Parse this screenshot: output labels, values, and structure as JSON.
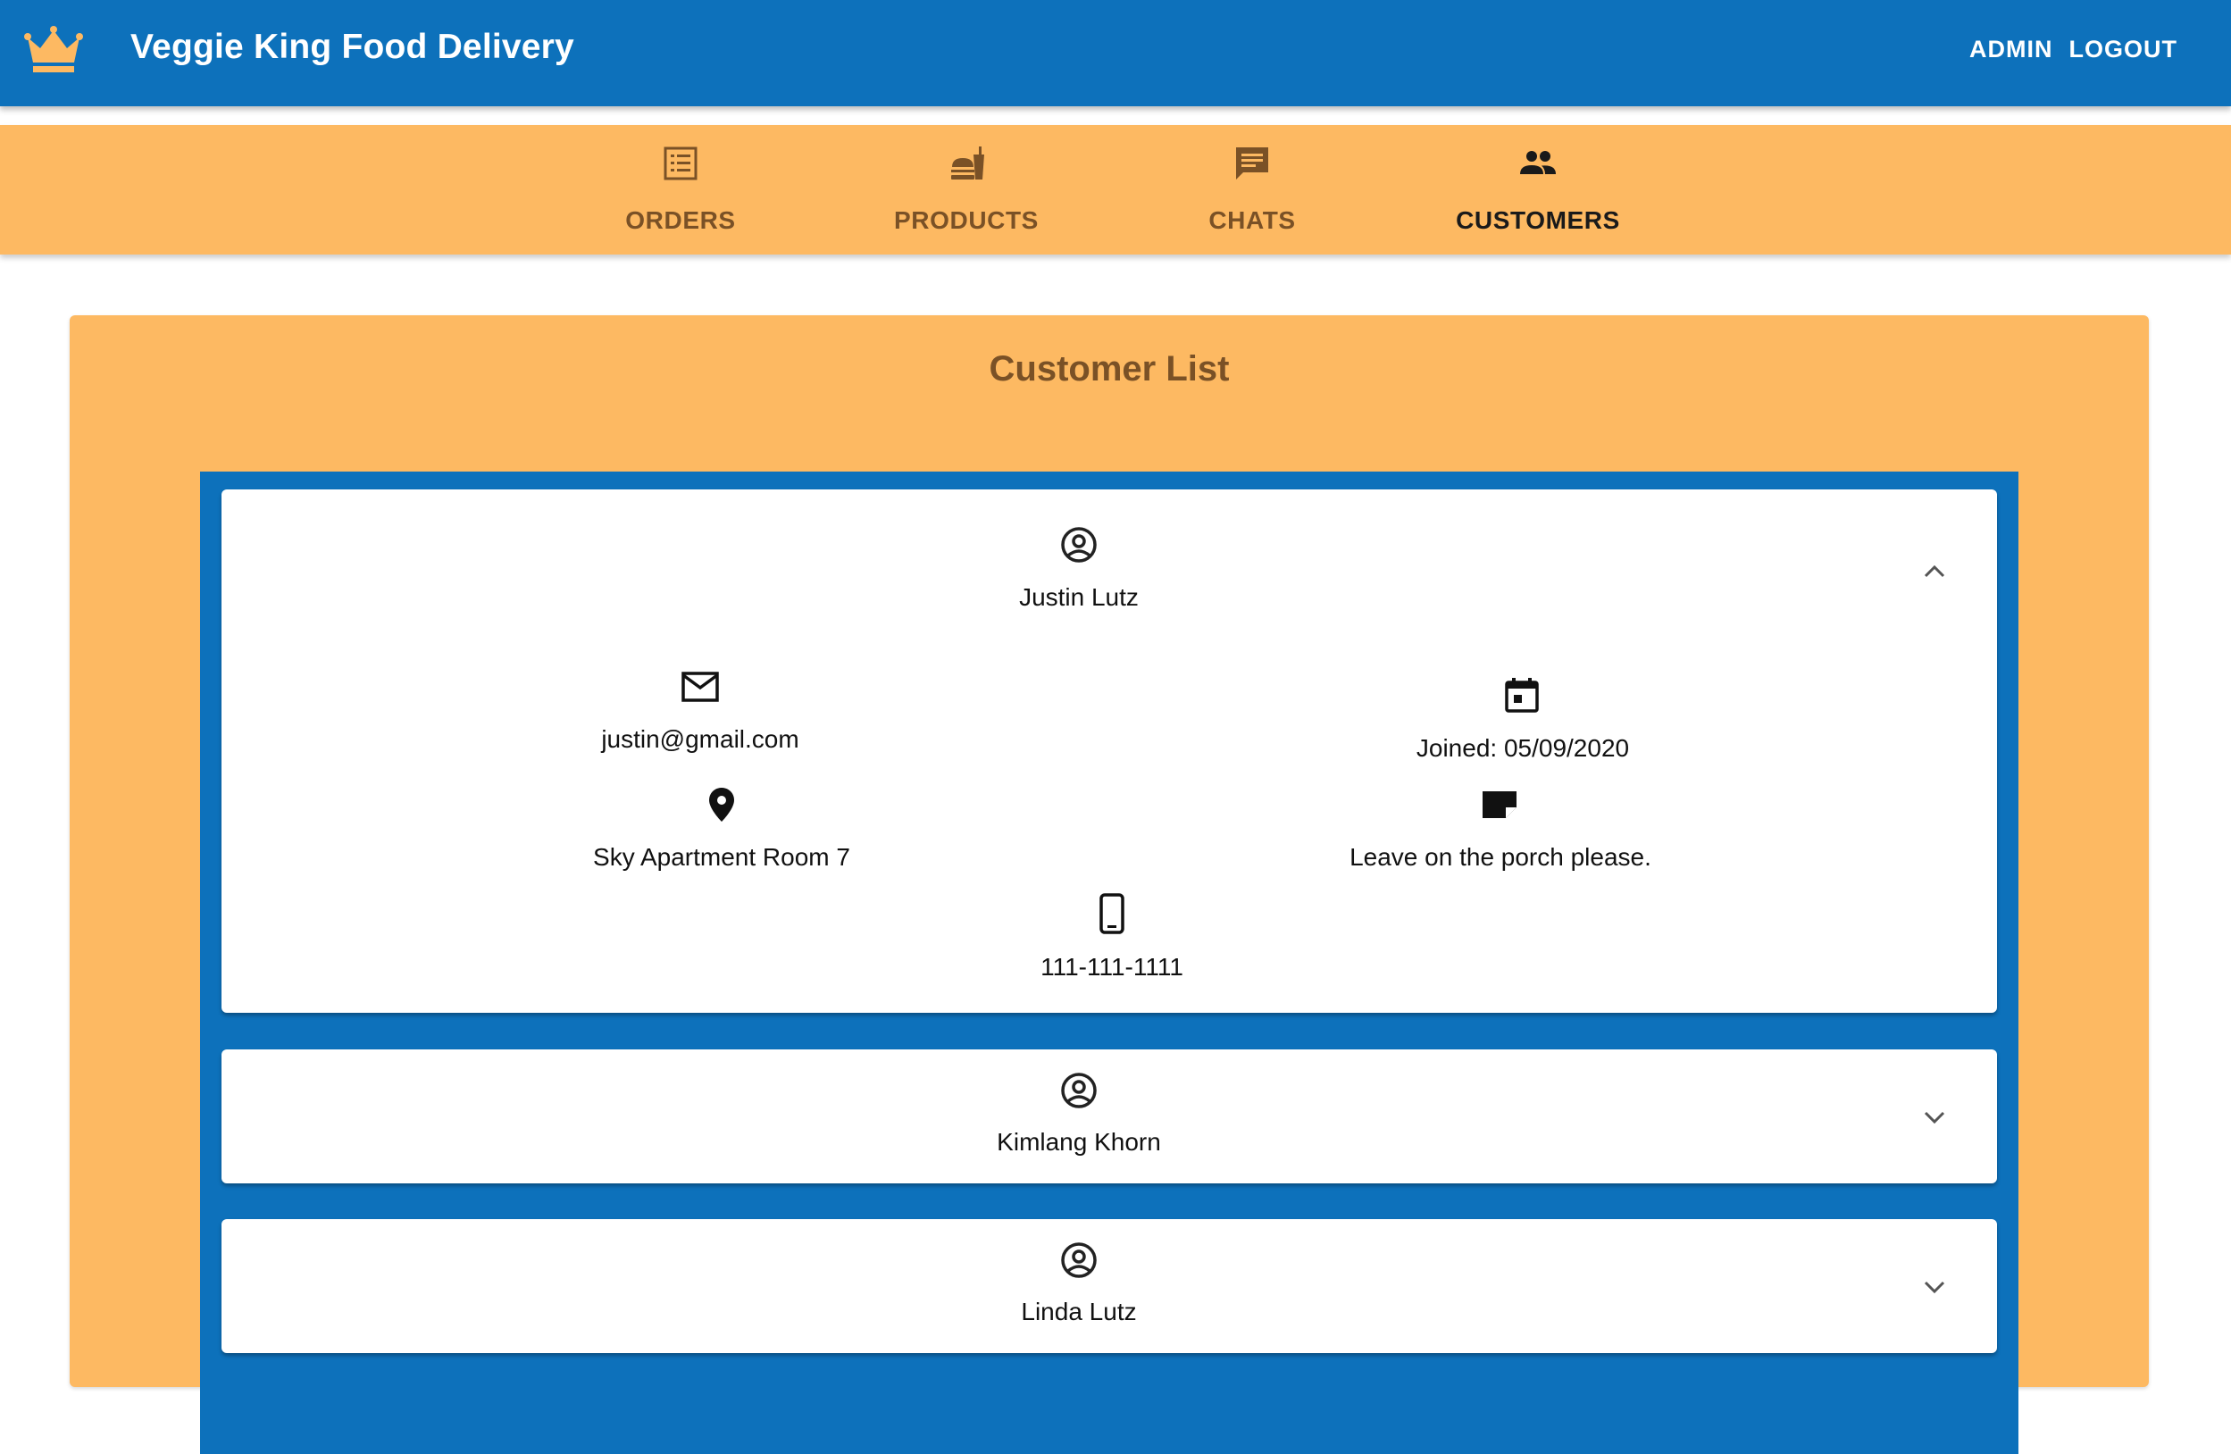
{
  "header": {
    "title": "Veggie King Food Delivery",
    "logo_icon": "crown-icon",
    "nav": [
      "ADMIN",
      "LOGOUT"
    ]
  },
  "tabs": [
    {
      "label": "ORDERS",
      "icon": "list-icon"
    },
    {
      "label": "PRODUCTS",
      "icon": "fastfood-icon"
    },
    {
      "label": "CHATS",
      "icon": "chat-icon"
    },
    {
      "label": "CUSTOMERS",
      "icon": "people-icon",
      "active": true
    }
  ],
  "panel": {
    "title": "Customer List"
  },
  "customers": [
    {
      "name": "Justin Lutz",
      "expanded": true,
      "email": "justin@gmail.com",
      "joined": "Joined: 05/09/2020",
      "address": "Sky Apartment Room 7",
      "note": "Leave on the porch please.",
      "phone": "111-111-1111"
    },
    {
      "name": "Kimlang Khorn",
      "expanded": false
    },
    {
      "name": "Linda Lutz",
      "expanded": false
    }
  ],
  "colors": {
    "primary_blue": "#0d71bb",
    "accent_orange": "#fdb962",
    "brown_text": "#7a5126"
  }
}
